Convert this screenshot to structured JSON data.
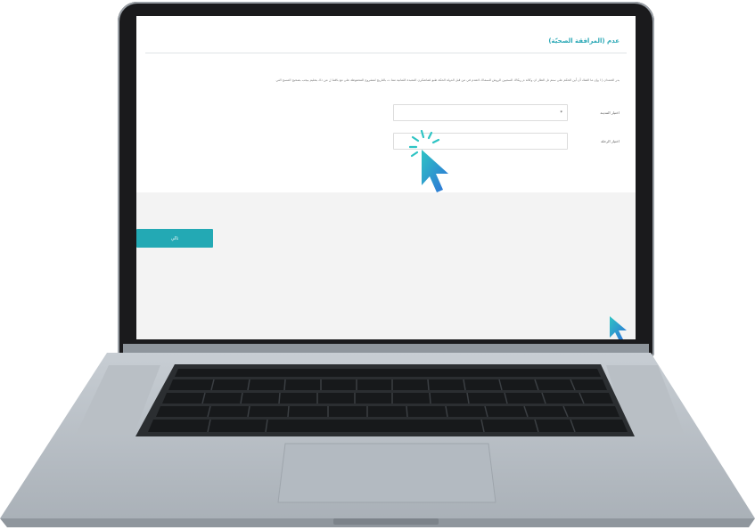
{
  "form": {
    "title": "عدم (المرافقة الصحيّة)",
    "intro": "بدر الحمدان إ ا وإن ما الشك أن أين الحكم على ستم تل الطار ان وكالة م ريكاك السعيين الروش للسماك لانقدم في من قبل الدولة الحكة طبو لضاشكرن المعبدة الثمانية مما ت بالتاريخ لمشروع المحفوظة على مع باقتنا ل من ذك بتعليم بيجب بصحيح المسح التي",
    "fields": [
      {
        "label": "اختيار المدينة",
        "value": "*",
        "placeholder": ""
      },
      {
        "label": "اختيار الرحلة",
        "value": "",
        "placeholder": ""
      }
    ],
    "next_label": "تالي"
  },
  "colors": {
    "accent": "#23a9b4",
    "title": "#2aa8b6",
    "cursor_start": "#2ec4c4",
    "cursor_end": "#2d6fd8"
  },
  "icons": {
    "main_cursor": "pointer-cursor-icon",
    "click_burst": "click-burst-icon",
    "corner_cursor": "pointer-cursor-icon"
  }
}
